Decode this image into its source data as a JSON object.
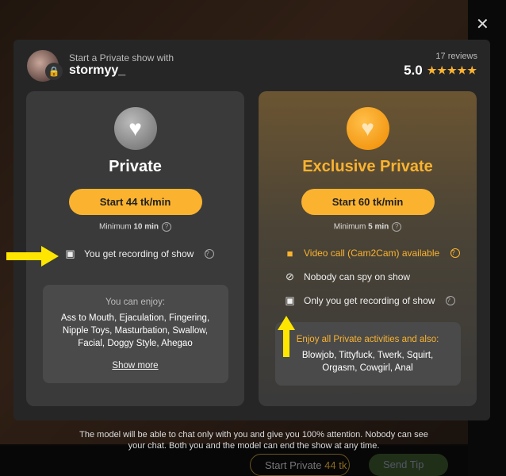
{
  "header": {
    "subtitle": "Start a Private show with",
    "username": "stormyy_",
    "reviews": "17 reviews",
    "rating": "5.0",
    "stars": 5
  },
  "private": {
    "title": "Private",
    "button": "Start 44 tk/min",
    "minimum_label": "Minimum",
    "minimum_value": "10 min",
    "features": [
      {
        "icon": "recording-icon",
        "text": "You get recording of show"
      }
    ],
    "enjoy_title": "You can enjoy:",
    "enjoy_list": "Ass to Mouth, Ejaculation, Fingering, Nipple Toys, Masturbation, Swallow, Facial, Doggy Style, Ahegao",
    "show_more": "Show more"
  },
  "exclusive": {
    "title": "Exclusive Private",
    "button": "Start 60 tk/min",
    "minimum_label": "Minimum",
    "minimum_value": "5 min",
    "features": [
      {
        "icon": "video-camera-icon",
        "text": "Video call (Cam2Cam) available"
      },
      {
        "icon": "eye-off-icon",
        "text": "Nobody can spy on show"
      },
      {
        "icon": "recording-icon",
        "text": "Only you get recording of show"
      }
    ],
    "enjoy_title": "Enjoy all Private activities and also:",
    "enjoy_list": "Blowjob, Tittyfuck, Twerk, Squirt, Orgasm, Cowgirl, Anal"
  },
  "footer": "The model will be able to chat only with you and give you 100% attention. Nobody can see your chat. Both you and the model can end the show at any time.",
  "bottom": {
    "start_private": "Start Private",
    "start_private_price": "44 tk",
    "send_tip": "Send Tip"
  },
  "colors": {
    "accent": "#fbb32f",
    "modal": "#262626",
    "card": "#3a3a3a"
  }
}
